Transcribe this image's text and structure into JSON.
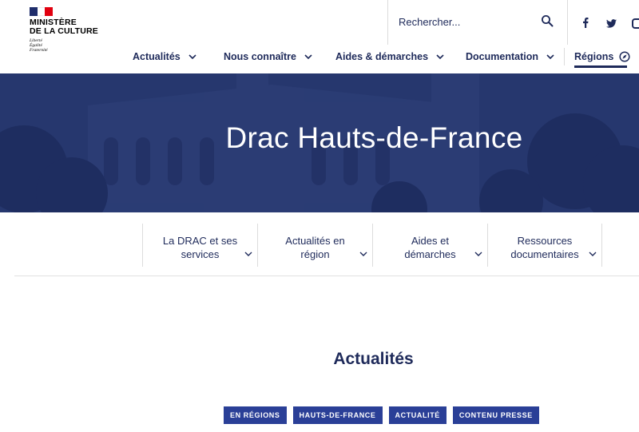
{
  "logo": {
    "title_line1": "MINISTÈRE",
    "title_line2": "DE LA CULTURE",
    "motto": [
      "Liberté",
      "Égalité",
      "Fraternité"
    ]
  },
  "search": {
    "placeholder": "Rechercher...",
    "icon": "search-icon"
  },
  "social": [
    "facebook-icon",
    "twitter-icon",
    "instagram-icon"
  ],
  "nav": {
    "items": [
      {
        "label": "Actualités"
      },
      {
        "label": "Nous connaître"
      },
      {
        "label": "Aides & démarches"
      },
      {
        "label": "Documentation"
      },
      {
        "label": "Régions"
      }
    ]
  },
  "hero": {
    "title": "Drac Hauts-de-France"
  },
  "subnav": {
    "items": [
      {
        "line1": "La DRAC et ses",
        "line2": "services"
      },
      {
        "line1": "Actualités en",
        "line2": "région"
      },
      {
        "line1": "Aides et",
        "line2": "démarches"
      },
      {
        "line1": "Ressources",
        "line2": "documentaires"
      }
    ]
  },
  "content": {
    "section_title": "Actualités",
    "tags": [
      "EN RÉGIONS",
      "HAUTS-DE-FRANCE",
      "ACTUALITÉ",
      "CONTENU PRESSE"
    ]
  },
  "colors": {
    "brand_navy": "#1e2a5a",
    "hero_blue": "#25356d",
    "tag_blue": "#2a3f97",
    "flag_red": "#e1000f"
  }
}
